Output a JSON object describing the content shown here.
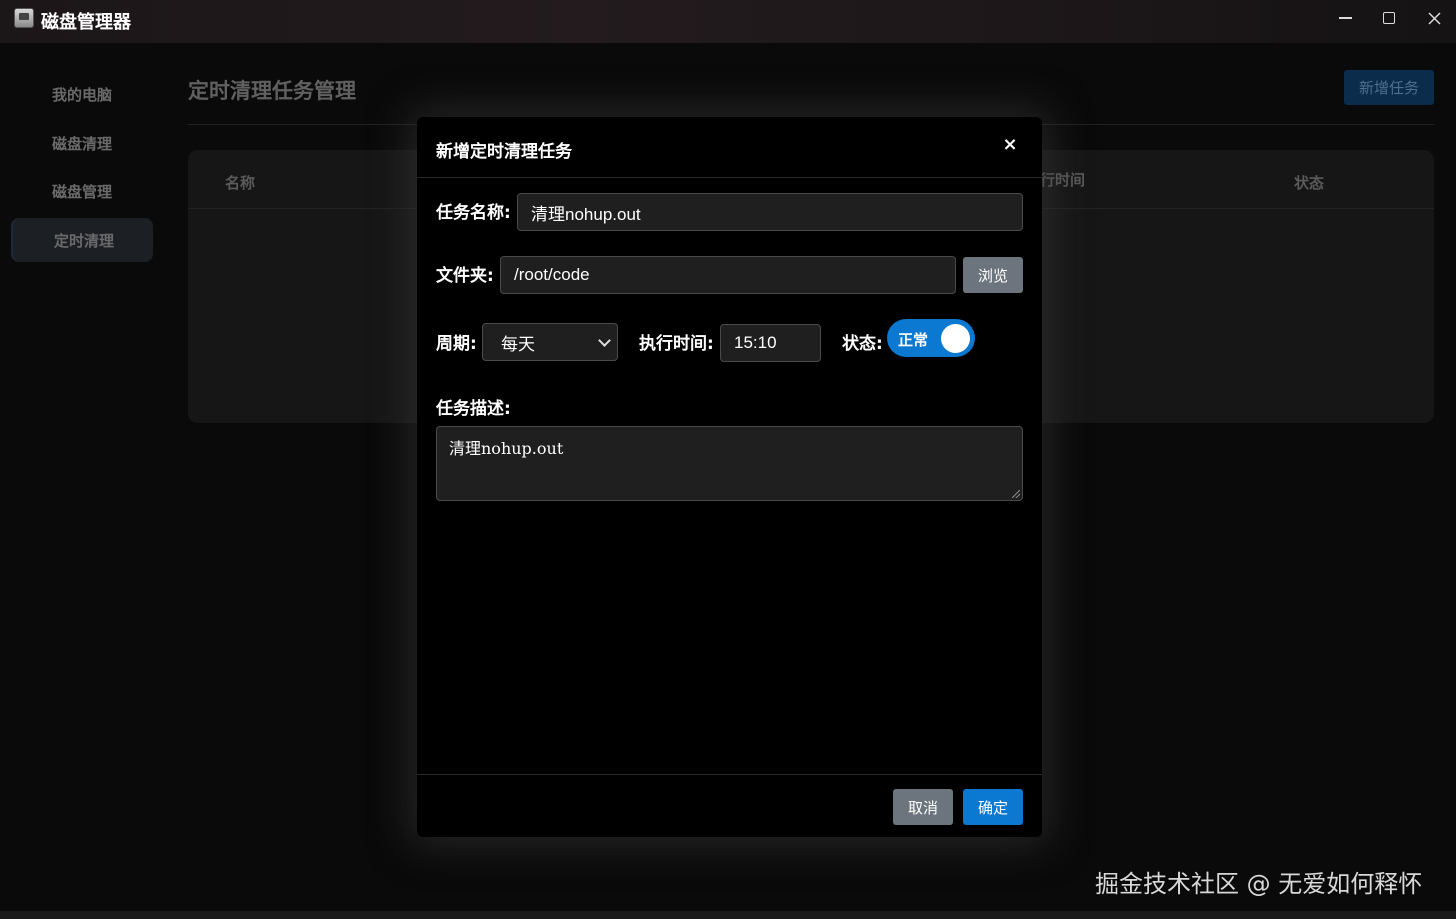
{
  "window": {
    "title": "磁盘管理器"
  },
  "sidebar": {
    "items": [
      {
        "label": "我的电脑"
      },
      {
        "label": "磁盘清理"
      },
      {
        "label": "磁盘管理"
      },
      {
        "label": "定时清理",
        "active": true
      }
    ]
  },
  "page": {
    "title": "定时清理任务管理",
    "add_button": "新增任务",
    "table": {
      "columns": {
        "name": "名称",
        "time": "行时间",
        "status": "状态"
      }
    }
  },
  "modal": {
    "title": "新增定时清理任务",
    "close_label": "×",
    "task_name_label": "任务名称:",
    "task_name_value": "清理nohup.out",
    "folder_label": "文件夹:",
    "folder_value": "/root/code",
    "browse_label": "浏览",
    "period_label": "周期:",
    "period_value": "每天",
    "exec_time_label": "执行时间:",
    "exec_time_value": "15:10",
    "status_label": "状态:",
    "status_toggle_label": "正常",
    "status_on": true,
    "description_label": "任务描述:",
    "description_value": "清理nohup.out",
    "cancel_label": "取消",
    "ok_label": "确定"
  },
  "watermark": "掘金技术社区 @ 无爱如何释怀",
  "colors": {
    "primary": "#0b78d1",
    "secondary": "#6c757d"
  }
}
